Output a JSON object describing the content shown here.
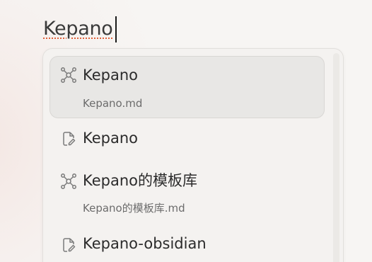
{
  "search": {
    "query": "Kepano"
  },
  "results": [
    {
      "title": "Kepano",
      "subtitle": "Kepano.md",
      "icon": "graph-network-icon"
    },
    {
      "title": "Kepano",
      "subtitle": "",
      "icon": "file-edit-icon"
    },
    {
      "title": "Kepano的模板库",
      "subtitle": "Kepano的模板库.md",
      "icon": "graph-network-icon"
    },
    {
      "title": "Kepano-obsidian",
      "subtitle": "",
      "icon": "file-edit-icon"
    }
  ]
}
